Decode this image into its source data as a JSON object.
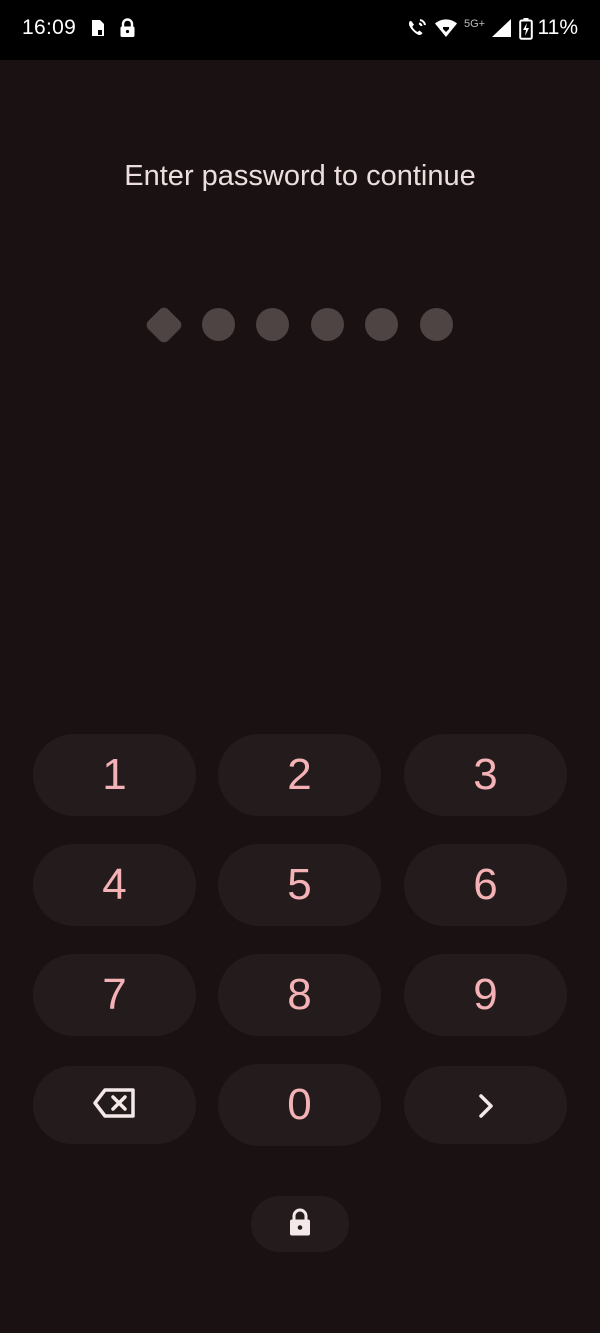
{
  "status_bar": {
    "time": "16:09",
    "network_label": "5G+",
    "battery_percent": "11%",
    "icons": [
      "sim-card-icon",
      "lock-icon",
      "wifi-calling-icon",
      "wifi-icon",
      "signal-icon",
      "battery-charging-icon"
    ]
  },
  "prompt": "Enter password to continue",
  "password_entry": {
    "entered_count": 6,
    "indicators": [
      "diamond",
      "dot",
      "dot",
      "dot",
      "dot",
      "dot"
    ]
  },
  "keypad": {
    "keys": [
      "1",
      "2",
      "3",
      "4",
      "5",
      "6",
      "7",
      "8",
      "9",
      "0"
    ],
    "backspace": "backspace-icon",
    "enter": "chevron-right-icon"
  },
  "lock_button": "lock-icon",
  "colors": {
    "background": "#1a1212",
    "key_background": "#241c1c",
    "key_text": "#f4b2b6",
    "indicator": "#4e4444"
  }
}
